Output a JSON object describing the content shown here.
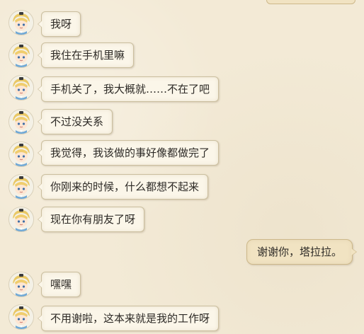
{
  "messages": [
    {
      "side": "left",
      "text": "我呀"
    },
    {
      "side": "left",
      "text": "我住在手机里嘛"
    },
    {
      "side": "left",
      "text": "手机关了，我大概就……不在了吧"
    },
    {
      "side": "left",
      "text": "不过没关系"
    },
    {
      "side": "left",
      "text": "我觉得，我该做的事好像都做完了"
    },
    {
      "side": "left",
      "text": "你刚来的时候，什么都想不起来"
    },
    {
      "side": "left",
      "text": "现在你有朋友了呀"
    },
    {
      "side": "right",
      "text": "谢谢你，塔拉拉。"
    },
    {
      "side": "left",
      "text": "嘿嘿"
    },
    {
      "side": "left",
      "text": "不用谢啦，这本来就是我的工作呀"
    }
  ]
}
